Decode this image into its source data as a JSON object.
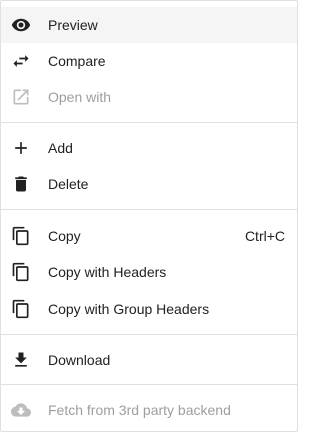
{
  "menu": {
    "items": [
      {
        "label": "Preview",
        "icon": "eye-icon",
        "state": "hover"
      },
      {
        "label": "Compare",
        "icon": "swap-arrows-icon"
      },
      {
        "label": "Open with",
        "icon": "open-external-icon",
        "state": "disabled"
      },
      {
        "label": "Add",
        "icon": "plus-icon"
      },
      {
        "label": "Delete",
        "icon": "trash-icon"
      },
      {
        "label": "Copy",
        "icon": "copy-icon",
        "shortcut": "Ctrl+C"
      },
      {
        "label": "Copy with Headers",
        "icon": "copy-icon"
      },
      {
        "label": "Copy with Group Headers",
        "icon": "copy-icon"
      },
      {
        "label": "Download",
        "icon": "download-icon"
      },
      {
        "label": "Fetch from 3rd party backend",
        "icon": "cloud-download-icon",
        "state": "disabled"
      }
    ]
  },
  "colors": {
    "text": "#212121",
    "disabled_text": "#9e9e9e",
    "icon": "#212121",
    "disabled_icon": "#bdbdbd",
    "hover_background": "#f5f5f5",
    "divider": "#e0e0e0"
  }
}
